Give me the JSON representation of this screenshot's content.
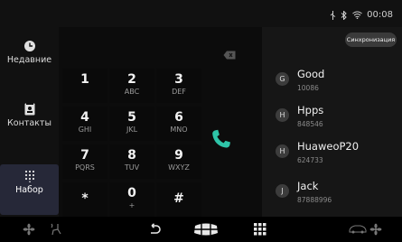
{
  "status_bar": {
    "time": "00:08",
    "icons": [
      "usb-icon",
      "bluetooth-icon",
      "wifi-icon"
    ]
  },
  "sidebar": {
    "items": [
      {
        "label": "Недавние",
        "icon": "clock-icon"
      },
      {
        "label": "Контакты",
        "icon": "contacts-book-icon"
      },
      {
        "label": "Набор",
        "icon": "dialpad-icon",
        "active": true
      }
    ]
  },
  "dialpad": {
    "keys": [
      {
        "digit": "1",
        "letters": ""
      },
      {
        "digit": "2",
        "letters": "ABC"
      },
      {
        "digit": "3",
        "letters": "DEF"
      },
      {
        "digit": "4",
        "letters": "GHI"
      },
      {
        "digit": "5",
        "letters": "JKL"
      },
      {
        "digit": "6",
        "letters": "MNO"
      },
      {
        "digit": "7",
        "letters": "PQRS"
      },
      {
        "digit": "8",
        "letters": "TUV"
      },
      {
        "digit": "9",
        "letters": "WXYZ"
      },
      {
        "digit": "*",
        "letters": ""
      },
      {
        "digit": "0",
        "letters": "+"
      },
      {
        "digit": "#",
        "letters": ""
      }
    ],
    "accent_color": "#2ec4a8"
  },
  "contacts": {
    "sync_label": "Синхронизация",
    "items": [
      {
        "initial": "G",
        "name": "Good",
        "number": "10086"
      },
      {
        "initial": "H",
        "name": "Hpps",
        "number": "848546"
      },
      {
        "initial": "H",
        "name": "HuaweoP20",
        "number": "624733"
      },
      {
        "initial": "J",
        "name": "Jack",
        "number": "87888996"
      }
    ]
  },
  "bottom_bar": {
    "icons": [
      "fan-left-icon",
      "seat-heat-icon",
      "back-icon",
      "car-menu-icon",
      "apps-grid-icon",
      "car-icon",
      "fan-right-icon"
    ]
  }
}
